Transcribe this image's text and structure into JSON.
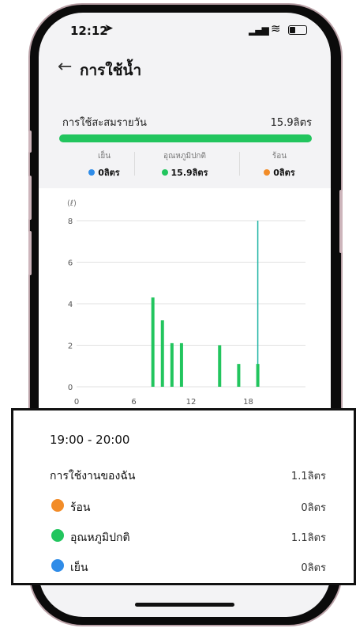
{
  "status_bar": {
    "time": "12:12",
    "location_icon": "➤",
    "signal_icon": "▂▄▆",
    "wifi_icon": "≋"
  },
  "header": {
    "back_icon": "←",
    "title": "การใช้น้ำ"
  },
  "summary": {
    "label": "การใช้สะสมรายวัน",
    "value": "15.9ลิตร",
    "progress_percent": 100,
    "segments": [
      {
        "label": "เย็น",
        "value": "0ลิตร",
        "color": "#2f8ce8"
      },
      {
        "label": "อุณหภูมิปกติ",
        "value": "15.9ลิตร",
        "color": "#22c55e"
      },
      {
        "label": "ร้อน",
        "value": "0ลิตร",
        "color": "#f28c28"
      }
    ]
  },
  "chart_data": {
    "type": "bar",
    "unit_label": "(ℓ)",
    "y_ticks": [
      "0",
      "2",
      "4",
      "6",
      "8"
    ],
    "x_ticks": [
      "0",
      "6",
      "12",
      "18"
    ],
    "ylim": [
      0,
      8
    ],
    "xlim": [
      0,
      24
    ],
    "grid": true,
    "bar_color": "#22c55e",
    "highlight_color": "#1fb5a4",
    "highlight_hour": 19,
    "bars": [
      {
        "hour": 8,
        "value": 4.3
      },
      {
        "hour": 9,
        "value": 3.2
      },
      {
        "hour": 10,
        "value": 2.1
      },
      {
        "hour": 11,
        "value": 2.1
      },
      {
        "hour": 15,
        "value": 2.0
      },
      {
        "hour": 17,
        "value": 1.1
      },
      {
        "hour": 19,
        "value": 1.1
      }
    ]
  },
  "popup": {
    "range": "19:00 - 20:00",
    "rows": [
      {
        "label": "การใช้งานของฉัน",
        "value": "1.1ลิตร"
      },
      {
        "label": "ร้อน",
        "value": "0ลิตร",
        "color": "#f28c28"
      },
      {
        "label": "อุณหภูมิปกติ",
        "value": "1.1ลิตร",
        "color": "#22c55e"
      },
      {
        "label": "เย็น",
        "value": "0ลิตร",
        "color": "#2f8ce8"
      }
    ]
  }
}
